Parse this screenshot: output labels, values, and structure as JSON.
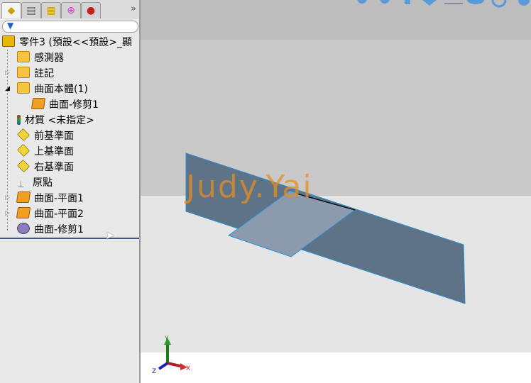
{
  "panel": {
    "tabs": [
      {
        "icon": "feature-manager-icon"
      },
      {
        "icon": "property-manager-icon"
      },
      {
        "icon": "configuration-manager-icon"
      },
      {
        "icon": "dimxpert-icon"
      },
      {
        "icon": "display-manager-icon"
      }
    ],
    "more": "»",
    "filter_icon": "filter-icon",
    "tree": [
      {
        "label": "零件3 (預設<<預設>_顯",
        "icon": "part-icon"
      },
      {
        "label": "感測器",
        "icon": "sensor-folder-icon"
      },
      {
        "label": "註記",
        "icon": "annotation-folder-icon"
      },
      {
        "label": "曲面本體(1)",
        "icon": "surface-bodies-folder-icon"
      },
      {
        "label": "曲面-修剪1",
        "icon": "surface-body-icon"
      },
      {
        "label": "材質 <未指定>",
        "icon": "material-icon"
      },
      {
        "label": "前基準面",
        "icon": "plane-icon"
      },
      {
        "label": "上基準面",
        "icon": "plane-icon"
      },
      {
        "label": "右基準面",
        "icon": "plane-icon"
      },
      {
        "label": "原點",
        "icon": "origin-icon"
      },
      {
        "label": "曲面-平面1",
        "icon": "planar-surface-icon"
      },
      {
        "label": "曲面-平面2",
        "icon": "planar-surface-icon"
      },
      {
        "label": "曲面-修剪1",
        "icon": "trim-surface-icon"
      }
    ]
  },
  "viewport": {
    "watermark": "Judy.Yai",
    "triad": {
      "x": "X",
      "y": "Y",
      "z": "Z"
    },
    "colors": {
      "surface": "#5f7387",
      "surface_light": "#8c9aae",
      "edge": "#2a8fd6"
    }
  }
}
